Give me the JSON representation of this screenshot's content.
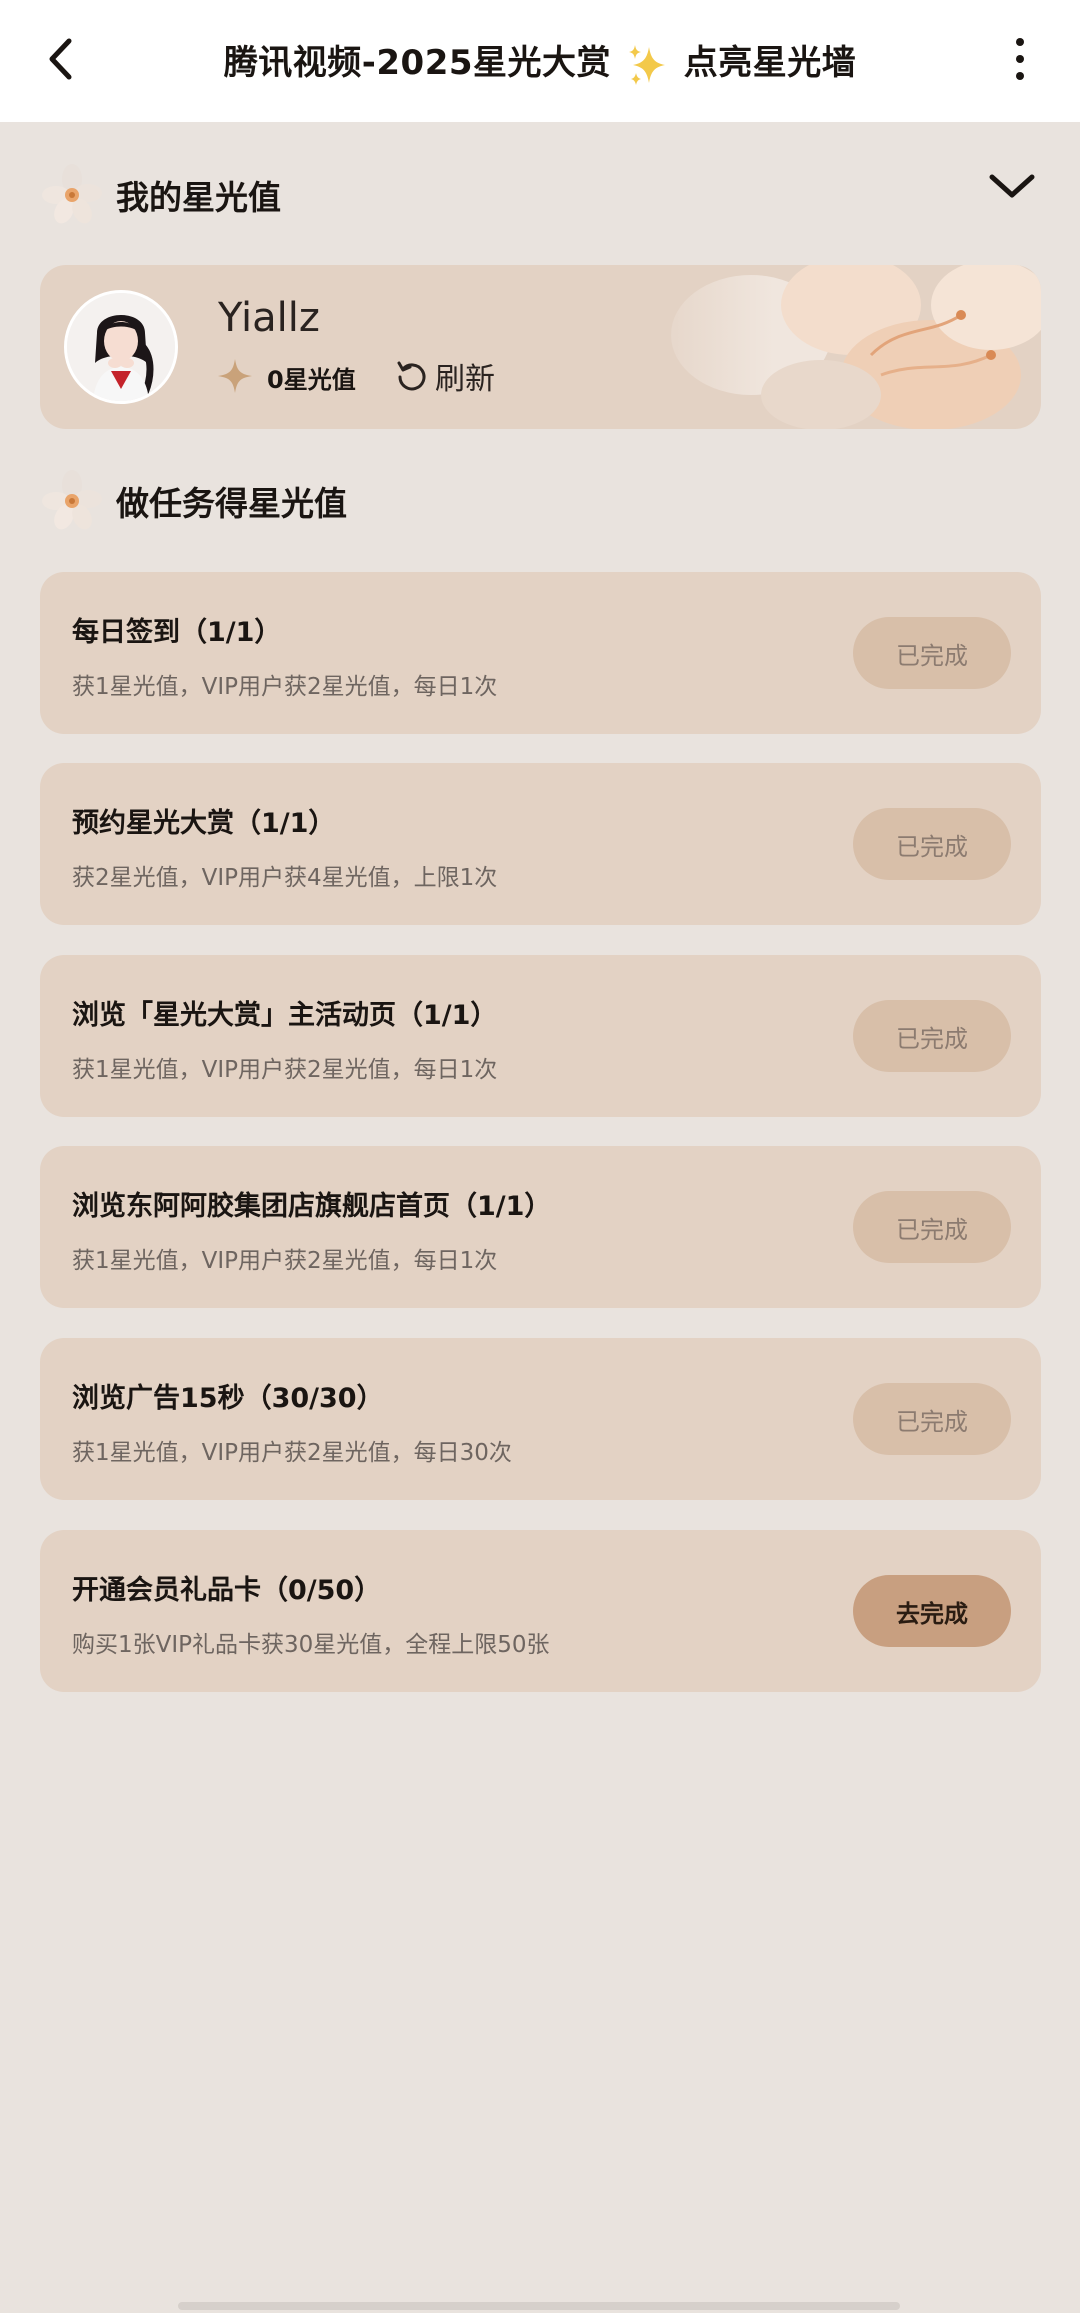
{
  "header": {
    "title_prefix": "腾讯视频-2025星光大赏",
    "title_suffix": "点亮星光墙"
  },
  "my_star": {
    "section_title": "我的星光值",
    "username": "Yiallz",
    "star_value": "0星光值",
    "refresh_label": "刷新"
  },
  "tasks_section": {
    "section_title": "做任务得星光值"
  },
  "tasks": [
    {
      "title": "每日签到（1/1）",
      "desc": "获1星光值，VIP用户获2星光值，每日1次",
      "button": "已完成",
      "status": "done"
    },
    {
      "title": "预约星光大赏（1/1）",
      "desc": "获2星光值，VIP用户获4星光值，上限1次",
      "button": "已完成",
      "status": "done"
    },
    {
      "title": "浏览「星光大赏」主活动页（1/1）",
      "desc": "获1星光值，VIP用户获2星光值，每日1次",
      "button": "已完成",
      "status": "done"
    },
    {
      "title": "浏览东阿阿胶集团店旗舰店首页（1/1）",
      "desc": "获1星光值，VIP用户获2星光值，每日1次",
      "button": "已完成",
      "status": "done"
    },
    {
      "title": "浏览广告15秒（30/30）",
      "desc": "获1星光值，VIP用户获2星光值，每日30次",
      "button": "已完成",
      "status": "done"
    },
    {
      "title": "开通会员礼品卡（0/50）",
      "desc": "购买1张VIP礼品卡获30星光值，全程上限50张",
      "button": "去完成",
      "status": "todo"
    }
  ],
  "colors": {
    "background": "#e9e3de",
    "card": "#e3d2c4",
    "done_button": "#d8bfa9",
    "todo_button": "#c89f80",
    "star_accent": "#c9a27a"
  },
  "icons": {
    "back": "chevron-left-icon",
    "more": "more-vertical-icon",
    "sparkle": "sparkles-icon",
    "section": "flower-icon",
    "collapse": "chevron-down-icon",
    "star": "four-point-star-icon",
    "refresh": "refresh-icon"
  }
}
